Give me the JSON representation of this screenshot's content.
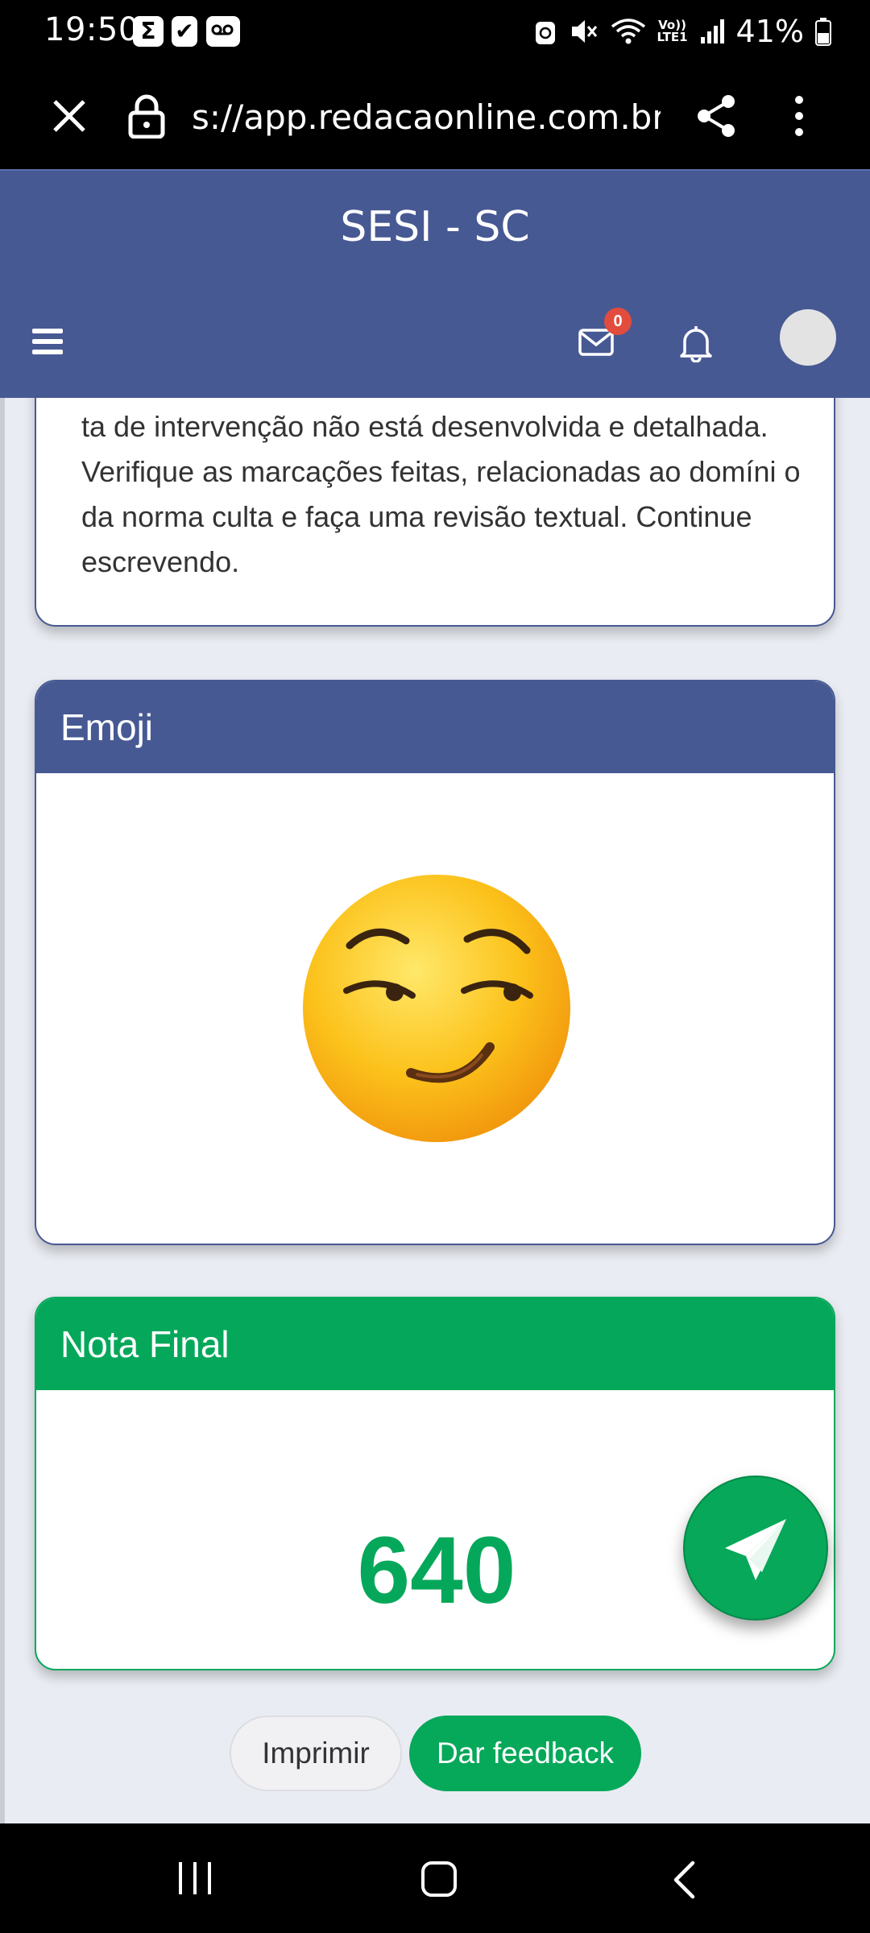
{
  "status_bar": {
    "time": "19:50",
    "battery_percent": "41%",
    "network_label_top": "Vo))",
    "network_label_bottom": "LTE1",
    "icons": [
      "sigma-app-icon",
      "check-icon",
      "voicemail-icon",
      "recycle-icon",
      "mute-icon",
      "wifi-icon",
      "signal-icon",
      "battery-icon"
    ]
  },
  "browser": {
    "url": "s://app.redacaonline.com.br/s",
    "close_icon": "close-icon",
    "lock_icon": "lock-icon",
    "share_icon": "share-icon",
    "more_icon": "more-vertical-icon"
  },
  "header": {
    "title": "SESI - SC",
    "mail_badge": "0",
    "colors": {
      "header_bg": "#475993",
      "badge": "#e24c3c"
    }
  },
  "comment_card": {
    "text": "ta de intervenção não está desenvolvida e detalhada. Verifique as marcações feitas, relacionadas ao domíni o da norma culta e faça uma revisão textual. Continue escrevendo."
  },
  "emoji_card": {
    "title": "Emoji",
    "emoji_icon": "smirking-face-emoji"
  },
  "nota_card": {
    "title": "Nota Final",
    "value": "640",
    "colors": {
      "accent": "#05a85a"
    }
  },
  "fab": {
    "icon": "send-paper-plane-icon"
  },
  "actions": {
    "print_label": "Imprimir",
    "feedback_label": "Dar feedback"
  },
  "nav": {
    "icons": [
      "recents-icon",
      "home-icon",
      "back-icon"
    ]
  }
}
